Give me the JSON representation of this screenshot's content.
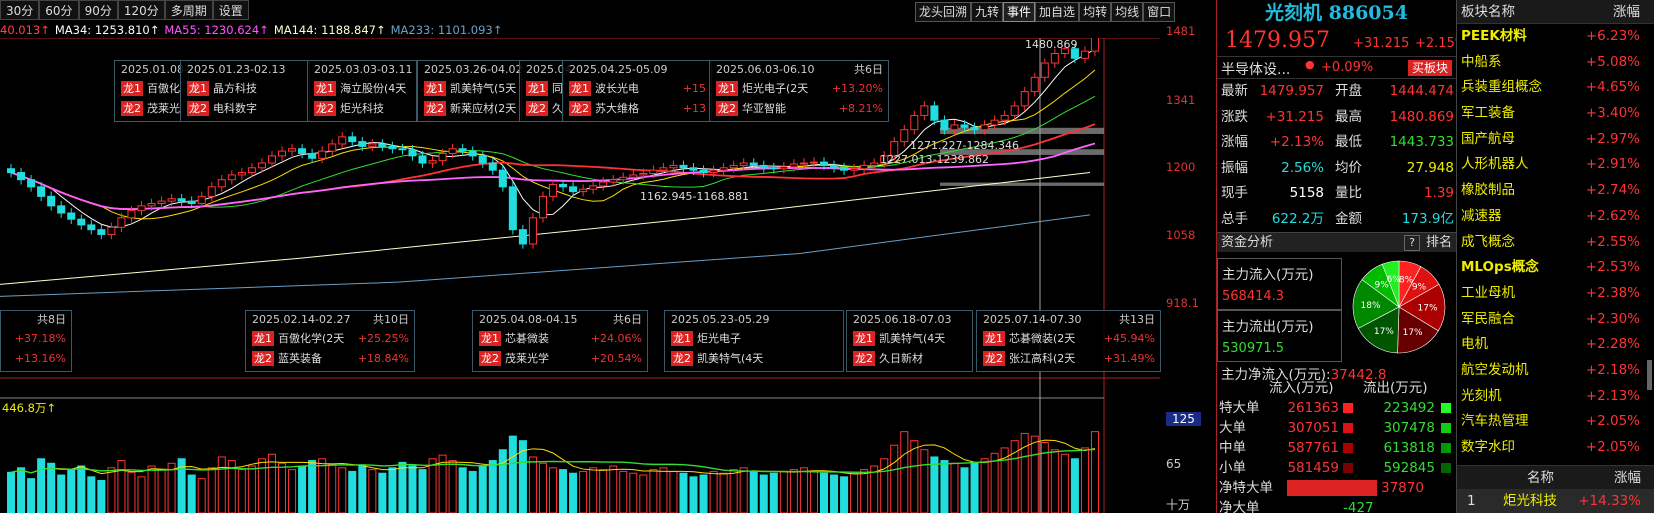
{
  "toolbar": {
    "left": [
      "30分",
      "60分",
      "90分",
      "120分",
      "多周期",
      "设置"
    ],
    "right": [
      "龙头回溯",
      "九转",
      "事件",
      "加自选",
      "均转",
      "均线",
      "窗口"
    ],
    "active_right": "事件"
  },
  "ma_legend": [
    {
      "text": "40.013↑",
      "color": "#ff4444"
    },
    {
      "text": "MA34: 1253.810↑",
      "color": "#ffffff"
    },
    {
      "text": "MA55: 1230.624↑",
      "color": "#ff55ff"
    },
    {
      "text": "MA144: 1188.847↑",
      "color": "#ffffcc"
    },
    {
      "text": "MA233: 1101.093↑",
      "color": "#6aa0c8"
    }
  ],
  "price_axis": [
    "1481",
    "1341",
    "1200",
    "1058",
    "918.1"
  ],
  "volume_axis": {
    "top": "125",
    "mid": "65",
    "unit": "十万",
    "vol_label": "446.8万↑"
  },
  "chart_labels": {
    "high_point": "1480.869",
    "band_1": "1271.227-1284.346",
    "band_2": "1227.013-1239.862",
    "band_3": "1162.945-1168.881"
  },
  "annotations_top": [
    {
      "period": "2025.01.08-",
      "count": "",
      "dragon1": "百傲化",
      "dragon2": "茂莱光",
      "pct1": "",
      "pct2": ""
    },
    {
      "period": "2025.01.23-02.13",
      "count": "",
      "dragon1": "晶方科技",
      "dragon2": "电科数字",
      "pct1": "",
      "pct2": ""
    },
    {
      "period": "2025.03.03-03.11",
      "count": "",
      "dragon1": "海立股份(4天",
      "dragon2": "炬光科技",
      "pct1": "",
      "pct2": ""
    },
    {
      "period": "2025.03.26-04.02",
      "count": "",
      "dragon1": "凯美特气(5天",
      "dragon2": "新莱应材(2天",
      "pct1": "",
      "pct2": ""
    },
    {
      "period": "2025.04",
      "count": "",
      "dragon1": "同",
      "dragon2": "久",
      "pct1": "",
      "pct2": ""
    },
    {
      "period": "2025.04.25-05.09",
      "count": "",
      "dragon1": "波长光电",
      "dragon2": "苏大维格",
      "pct1": "+15",
      "pct2": "+13"
    },
    {
      "period": "2025.06.03-06.10",
      "count": "共6日",
      "dragon1": "炬光电子(2天",
      "dragon2": "华亚智能",
      "pct1": "+13.20%",
      "pct2": "+8.21%"
    }
  ],
  "annotations_bottom": [
    {
      "period": "",
      "count": "共8日",
      "dragon1": "",
      "dragon2": "",
      "pct1": "+37.18%",
      "pct2": "+13.16%"
    },
    {
      "period": "2025.02.14-02.27",
      "count": "共10日",
      "dragon1": "百傲化学(2天",
      "dragon2": "蓝英装备",
      "pct1": "+25.25%",
      "pct2": "+18.84%"
    },
    {
      "period": "2025.04.08-04.15",
      "count": "共6日",
      "dragon1": "芯碁微装",
      "dragon2": "茂莱光学",
      "pct1": "+24.06%",
      "pct2": "+20.54%"
    },
    {
      "period": "2025.05.23-05.29",
      "count": "",
      "dragon1": "炬光电子",
      "dragon2": "凯美特气(4天",
      "pct1": "",
      "pct2": ""
    },
    {
      "period": "2025.06.18-07.03",
      "count": "",
      "dragon1": "凯美特气(4天",
      "dragon2": "久日新材",
      "pct1": "",
      "pct2": ""
    },
    {
      "period": "2025.07.14-07.30",
      "count": "共13日",
      "dragon1": "芯碁微装(2天",
      "dragon2": "张江高科(2天",
      "pct1": "+45.94%",
      "pct2": "+31.49%"
    }
  ],
  "dragon_tags": {
    "d1": "龙1",
    "d2": "龙2"
  },
  "info": {
    "title": "光刻机 886054",
    "price": "1479.957",
    "change": "+31.215",
    "change_pct": "+2.15%",
    "sector_name": "半导体设...",
    "sector_dot": "●",
    "sector_pct": "+0.09%",
    "sector_btn": "买板块",
    "quote": [
      {
        "k1": "最新",
        "v1": "1479.957",
        "c1": "red",
        "k2": "开盘",
        "v2": "1444.474",
        "c2": "red"
      },
      {
        "k1": "涨跌",
        "v1": "+31.215",
        "c1": "red",
        "k2": "最高",
        "v2": "1480.869",
        "c2": "red"
      },
      {
        "k1": "涨幅",
        "v1": "+2.13%",
        "c1": "red",
        "k2": "最低",
        "v2": "1443.733",
        "c2": "green"
      },
      {
        "k1": "振幅",
        "v1": "2.56%",
        "c1": "cyan",
        "k2": "均价",
        "v2": "27.948",
        "c2": "yellow"
      },
      {
        "k1": "现手",
        "v1": "5158",
        "c1": "white",
        "k2": "量比",
        "v2": "1.39",
        "c2": "red"
      },
      {
        "k1": "总手",
        "v1": "622.2万",
        "c1": "cyan",
        "k2": "金额",
        "v2": "173.9亿",
        "c2": "cyan"
      }
    ],
    "fund_title": "资金分析",
    "fund_q": "?",
    "fund_rank": "排名",
    "inflow_label": "主力流入(万元)",
    "inflow_value": "568414.3",
    "outflow_label": "主力流出(万元)",
    "outflow_value": "530971.5",
    "net_label": "主力净流入(万元):",
    "net_value": "37442.8",
    "pie": [
      {
        "label": "8%",
        "value": 8,
        "color": "#ff2222"
      },
      {
        "label": "9%",
        "value": 9,
        "color": "#dd1111"
      },
      {
        "label": "17%",
        "value": 17,
        "color": "#aa0000"
      },
      {
        "label": "17%",
        "value": 17,
        "color": "#660000"
      },
      {
        "label": "17%",
        "value": 17,
        "color": "#005500"
      },
      {
        "label": "18%",
        "value": 18,
        "color": "#008800"
      },
      {
        "label": "9%",
        "value": 9,
        "color": "#00bb00"
      },
      {
        "label": "6%",
        "value": 6,
        "color": "#22ee22"
      }
    ],
    "flow_header": {
      "in": "流入(万元)",
      "out": "流出(万元)"
    },
    "flows": [
      {
        "k": "特大单",
        "in": "261363",
        "out": "223492",
        "cin": "#ff2222",
        "cout": "#22ff22"
      },
      {
        "k": "大单",
        "in": "307051",
        "out": "307478",
        "cin": "#dd1111",
        "cout": "#11cc11"
      },
      {
        "k": "中单",
        "in": "587761",
        "out": "613818",
        "cin": "#aa0000",
        "cout": "#009900"
      },
      {
        "k": "小单",
        "in": "581459",
        "out": "592845",
        "cin": "#770000",
        "cout": "#006600"
      }
    ],
    "net_rows": [
      {
        "k": "净特大单",
        "v": "37870",
        "color": "#f33"
      },
      {
        "k": "净大单",
        "v": "-427",
        "color": "#3d3"
      }
    ]
  },
  "sectors": {
    "header_name": "板块名称",
    "header_pct": "涨幅",
    "items": [
      {
        "name": "PEEK材料",
        "pct": "+6.23%",
        "bold": true
      },
      {
        "name": "中船系",
        "pct": "+5.08%",
        "bold": false
      },
      {
        "name": "兵装重组概念",
        "pct": "+4.65%",
        "bold": false
      },
      {
        "name": "军工装备",
        "pct": "+3.40%",
        "bold": false
      },
      {
        "name": "国产航母",
        "pct": "+2.97%",
        "bold": false
      },
      {
        "name": "人形机器人",
        "pct": "+2.91%",
        "bold": false
      },
      {
        "name": "橡胶制品",
        "pct": "+2.74%",
        "bold": false
      },
      {
        "name": "减速器",
        "pct": "+2.62%",
        "bold": false
      },
      {
        "name": "成飞概念",
        "pct": "+2.55%",
        "bold": false
      },
      {
        "name": "MLOps概念",
        "pct": "+2.53%",
        "bold": true
      },
      {
        "name": "工业母机",
        "pct": "+2.38%",
        "bold": false
      },
      {
        "name": "军民融合",
        "pct": "+2.30%",
        "bold": false
      },
      {
        "name": "电机",
        "pct": "+2.28%",
        "bold": false
      },
      {
        "name": "航空发动机",
        "pct": "+2.18%",
        "bold": false
      },
      {
        "name": "光刻机",
        "pct": "+2.13%",
        "bold": false
      },
      {
        "name": "汽车热管理",
        "pct": "+2.05%",
        "bold": false
      },
      {
        "name": "数字水印",
        "pct": "+2.05%",
        "bold": false
      }
    ],
    "stock_header_name": "名称",
    "stock_header_pct": "涨幅",
    "stocks": [
      {
        "idx": "1",
        "name": "炬光科技",
        "pct": "+14.33%"
      }
    ]
  },
  "chart_data": {
    "type": "candlestick",
    "ylim": [
      918.1,
      1481
    ],
    "close": [
      1190,
      1175,
      1160,
      1140,
      1120,
      1105,
      1092,
      1080,
      1070,
      1060,
      1075,
      1095,
      1110,
      1120,
      1125,
      1130,
      1135,
      1130,
      1125,
      1140,
      1160,
      1175,
      1185,
      1190,
      1200,
      1210,
      1225,
      1235,
      1240,
      1230,
      1220,
      1235,
      1250,
      1265,
      1255,
      1245,
      1250,
      1245,
      1240,
      1238,
      1225,
      1210,
      1215,
      1230,
      1240,
      1235,
      1225,
      1210,
      1195,
      1160,
      1070,
      1040,
      1095,
      1140,
      1165,
      1160,
      1150,
      1155,
      1162,
      1170,
      1175,
      1180,
      1185,
      1188,
      1195,
      1200,
      1205,
      1200,
      1195,
      1190,
      1195,
      1200,
      1205,
      1210,
      1205,
      1200,
      1198,
      1202,
      1208,
      1210,
      1212,
      1205,
      1200,
      1195,
      1198,
      1205,
      1210,
      1225,
      1255,
      1280,
      1310,
      1330,
      1300,
      1280,
      1290,
      1285,
      1280,
      1290,
      1300,
      1310,
      1330,
      1360,
      1390,
      1420,
      1440,
      1450,
      1430,
      1445,
      1480
    ],
    "volume": [
      45,
      50,
      38,
      60,
      55,
      42,
      48,
      52,
      40,
      36,
      50,
      58,
      45,
      40,
      52,
      48,
      55,
      60,
      42,
      38,
      50,
      62,
      58,
      48,
      52,
      60,
      65,
      55,
      48,
      52,
      58,
      60,
      54,
      50,
      46,
      52,
      48,
      44,
      50,
      56,
      52,
      48,
      60,
      64,
      58,
      50,
      46,
      52,
      58,
      70,
      85,
      80,
      62,
      55,
      50,
      48,
      44,
      46,
      50,
      48,
      52,
      46,
      44,
      42,
      48,
      50,
      46,
      44,
      40,
      42,
      46,
      44,
      48,
      50,
      46,
      42,
      44,
      46,
      48,
      50,
      46,
      44,
      42,
      40,
      44,
      48,
      52,
      60,
      75,
      90,
      80,
      70,
      62,
      58,
      55,
      50,
      56,
      60,
      66,
      72,
      80,
      88,
      85,
      78,
      70,
      65,
      60,
      72,
      90
    ]
  }
}
